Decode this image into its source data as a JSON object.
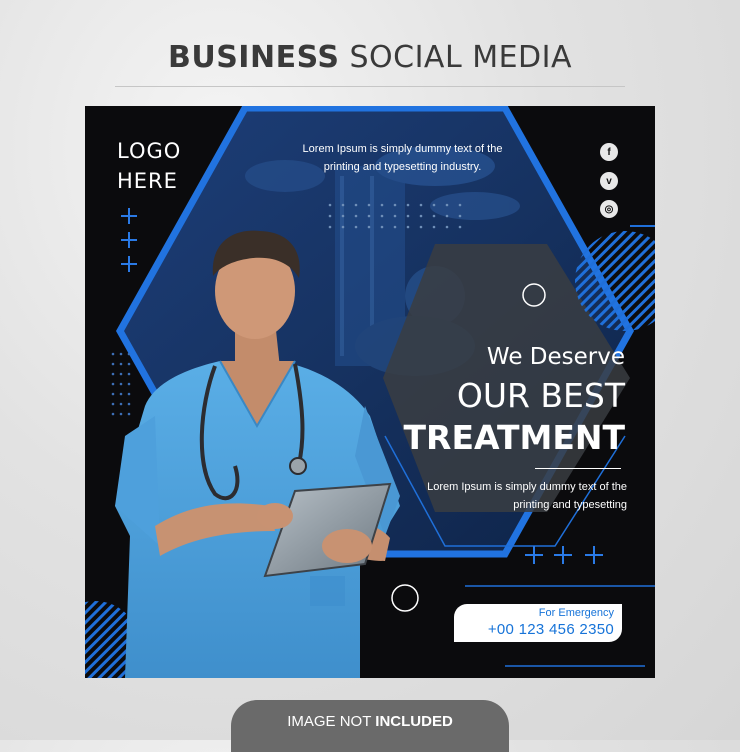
{
  "header": {
    "title_bold": "BUSINESS",
    "title_light": "SOCIAL MEDIA"
  },
  "post": {
    "logo": {
      "line1": "LOGO",
      "line2": "HERE"
    },
    "top_text": "Lorem Ipsum is simply dummy text of the printing and typesetting industry.",
    "social_icons": [
      {
        "name": "facebook-icon",
        "glyph": "f"
      },
      {
        "name": "vimeo-icon",
        "glyph": "v"
      },
      {
        "name": "instagram-icon",
        "glyph": "◎"
      }
    ],
    "headline": {
      "line1": "We Deserve",
      "line2": "OUR BEST",
      "line3": "TREATMENT"
    },
    "body_text": "Lorem Ipsum is simply dummy text of the printing and typesetting",
    "emergency": {
      "label": "For Emergency",
      "phone": "+00 123 456 2350"
    },
    "colors": {
      "accent": "#1f6fd9",
      "background": "#0b0b0d",
      "scrubs": "#4a9ed8"
    }
  },
  "footer_tab": {
    "text_normal": "IMAGE NOT ",
    "text_bold": "INCLUDED"
  }
}
